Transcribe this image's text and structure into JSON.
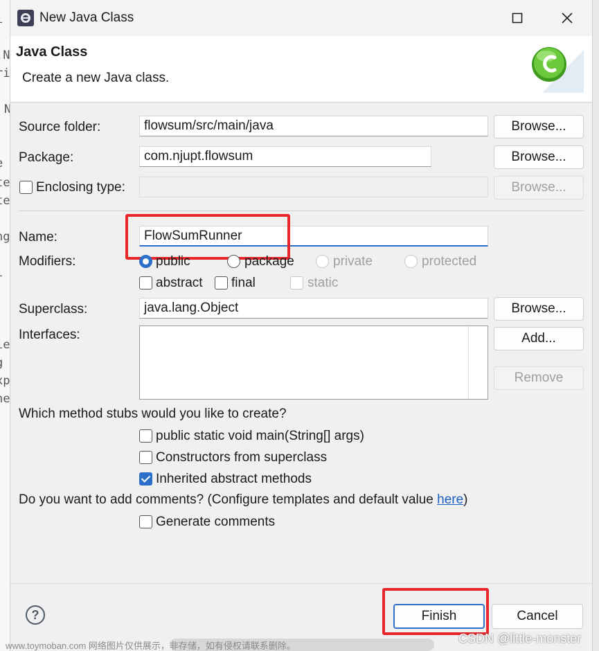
{
  "window": {
    "title": "New Java Class"
  },
  "banner": {
    "heading": "Java Class",
    "description": "Create a new Java class."
  },
  "form": {
    "source_folder_label": "Source folder:",
    "source_folder_value": "flowsum/src/main/java",
    "package_label": "Package:",
    "package_value": "com.njupt.flowsum",
    "enclosing_type_label": "Enclosing type:",
    "enclosing_type_value": "",
    "browse_label": "Browse...",
    "name_label": "Name:",
    "name_value": "FlowSumRunner",
    "modifiers_label": "Modifiers:",
    "modifiers": {
      "public": "public",
      "package": "package",
      "private": "private",
      "protected": "protected",
      "abstract": "abstract",
      "final": "final",
      "static": "static"
    },
    "superclass_label": "Superclass:",
    "superclass_value": "java.lang.Object",
    "interfaces_label": "Interfaces:",
    "add_label": "Add...",
    "remove_label": "Remove",
    "stubs_question": "Which method stubs would you like to create?",
    "stubs": {
      "main": "public static void main(String[] args)",
      "constructors": "Constructors from superclass",
      "inherited": "Inherited abstract methods"
    },
    "comments_question": "Do you want to add comments? (Configure templates and default value ",
    "comments_link": "here",
    "comments_close": ")",
    "generate_comments": "Generate comments"
  },
  "footer": {
    "help_icon": "?",
    "finish_label": "Finish",
    "cancel_label": "Cancel"
  },
  "background_code": [
    "i",
    ".N",
    "ri",
    "N",
    "e",
    "te",
    "te",
    "ng",
    "i",
    "ie",
    "g",
    "xp",
    "ne"
  ],
  "watermarks": {
    "left": "www.toymoban.com 网络图片仅供展示，非存储，如有侵权请联系删除。",
    "right": "CSDN @little-monster"
  },
  "colors": {
    "accent": "#2b6fc9",
    "highlight": "#e8262b",
    "link": "#1a5fc2"
  }
}
